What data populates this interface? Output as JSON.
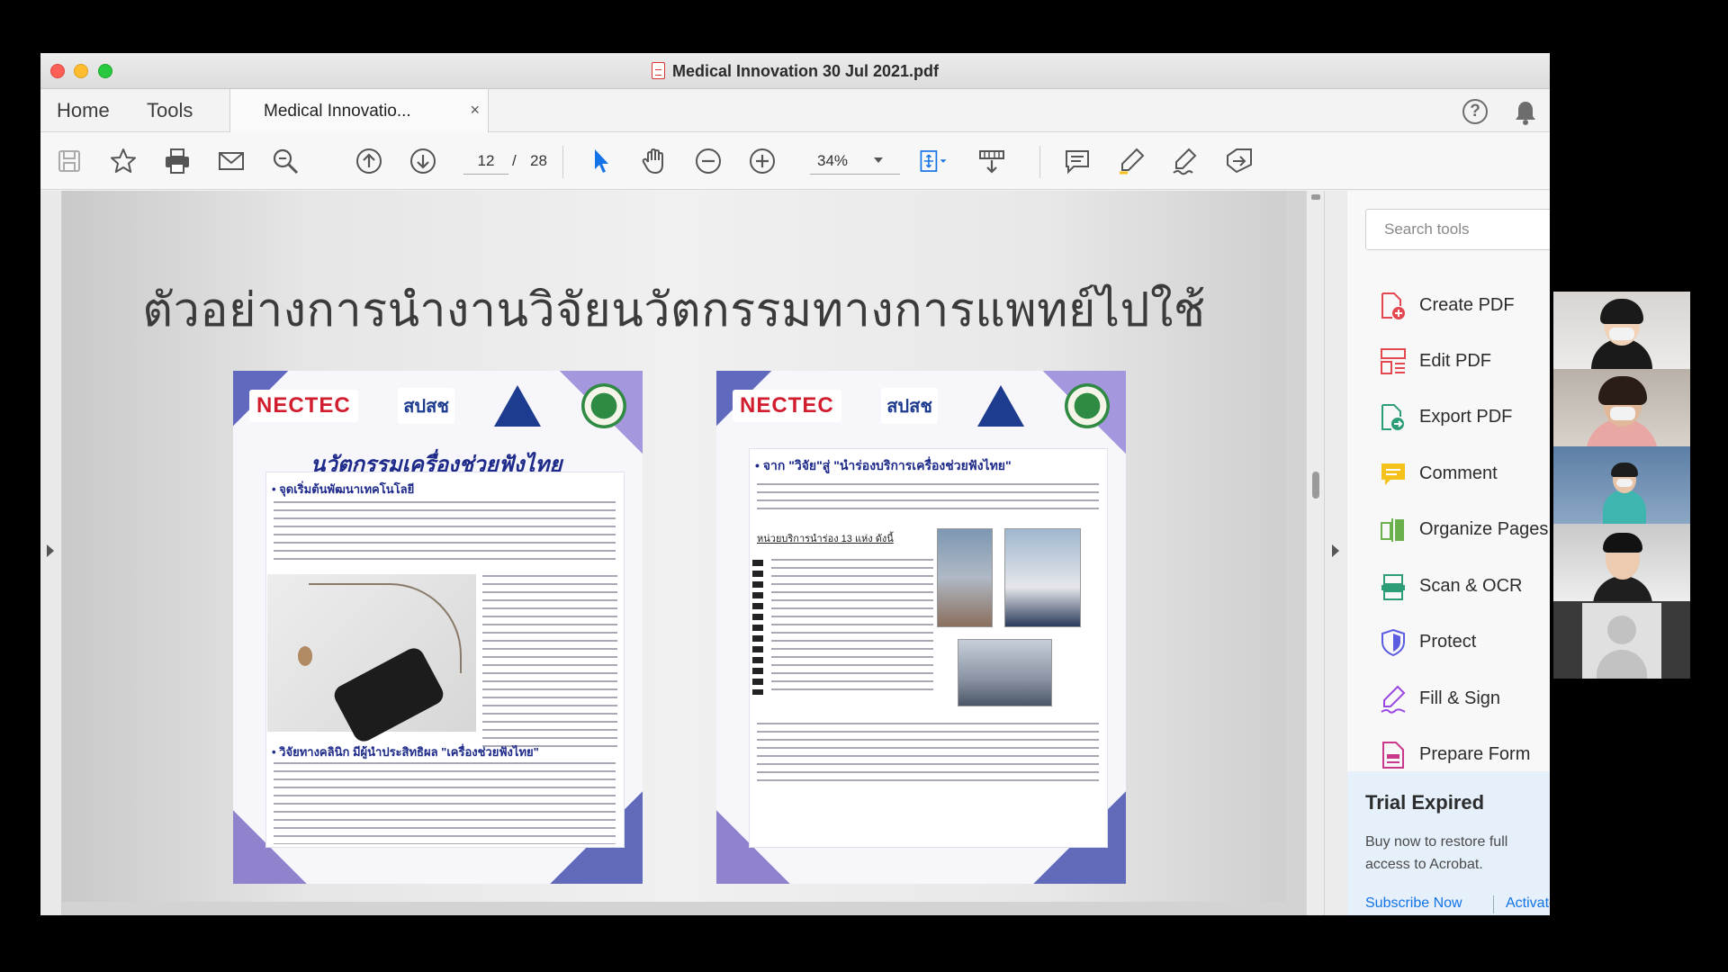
{
  "window": {
    "title": "Medical Innovation 30 Jul 2021.pdf"
  },
  "tabs": {
    "home": "Home",
    "tools": "Tools",
    "document": "Medical Innovatio...",
    "close": "×"
  },
  "toolbar": {
    "current_page": "12",
    "page_separator": "/",
    "total_pages": "28",
    "zoom": "34%",
    "icons": [
      "save-icon",
      "star-icon",
      "print-icon",
      "mail-icon",
      "search-zoom-icon",
      "page-up-icon",
      "page-down-icon",
      "select-arrow-icon",
      "hand-icon",
      "zoom-out-icon",
      "zoom-in-icon",
      "fit-page-icon",
      "read-mode-icon",
      "comment-icon",
      "highlight-pen-icon",
      "sign-icon",
      "share-icon"
    ]
  },
  "slide": {
    "title": "ตัวอย่างการนำงานวิจัยนวัตกรรมทางการแพทย์ไปใช้",
    "left_poster": {
      "logos": [
        "NECTEC",
        "สปสช"
      ],
      "banner": "นวัตกรรมเครื่องช่วยฟังไทย",
      "section1": "• จุดเริ่มต้นพัฒนาเทคโนโลยี",
      "section2": "• วิจัยทางคลินิก มีผู้นำประสิทธิผล \"เครื่องช่วยฟังไทย\""
    },
    "right_poster": {
      "logos": [
        "NECTEC",
        "สปสช"
      ],
      "banner": "• จาก \"วิจัย\"สู่ \"นำร่องบริการเครื่องช่วยฟังไทย\"",
      "subhead": "หน่วยบริการนำร่อง 13 แห่ง ดังนี้"
    }
  },
  "search": {
    "placeholder": "Search tools"
  },
  "tools_panel": {
    "items": [
      {
        "label": "Create PDF",
        "icon": "create-pdf-icon",
        "color": "#e34850"
      },
      {
        "label": "Edit PDF",
        "icon": "edit-pdf-icon",
        "color": "#e34850"
      },
      {
        "label": "Export PDF",
        "icon": "export-pdf-icon",
        "color": "#2d9d78"
      },
      {
        "label": "Comment",
        "icon": "comment-tool-icon",
        "color": "#f4c21a"
      },
      {
        "label": "Organize Pages",
        "icon": "organize-pages-icon",
        "color": "#6ab04c"
      },
      {
        "label": "Scan & OCR",
        "icon": "scan-ocr-icon",
        "color": "#2d9d78"
      },
      {
        "label": "Protect",
        "icon": "protect-shield-icon",
        "color": "#5c5ce0"
      },
      {
        "label": "Fill & Sign",
        "icon": "fill-sign-icon",
        "color": "#9a47e2"
      },
      {
        "label": "Prepare Form",
        "icon": "prepare-form-icon",
        "color": "#c9388b"
      }
    ]
  },
  "trial": {
    "title": "Trial Expired",
    "text": "Buy now to restore full access to Acrobat.",
    "subscribe": "Subscribe Now",
    "activate": "Activate"
  },
  "colors": {
    "accent_link": "#1473e6",
    "title_text": "#3b3b3b",
    "close_red": "#fe5f57",
    "minimize_yellow": "#febc2e",
    "zoom_green": "#28c840"
  },
  "video_participants": [
    "participant-1",
    "participant-2",
    "participant-3",
    "participant-4",
    "participant-5-avatar"
  ]
}
